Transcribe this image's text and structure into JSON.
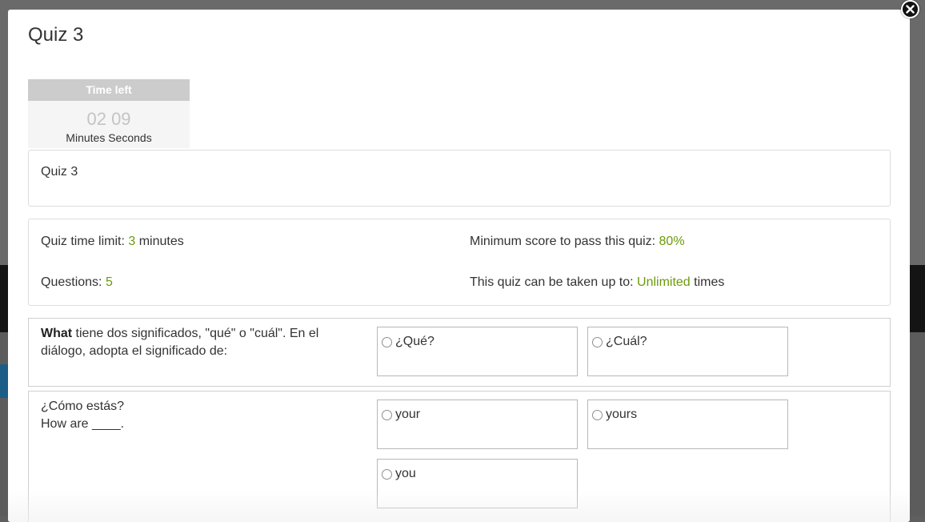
{
  "modal": {
    "title": "Quiz 3"
  },
  "timer": {
    "header": "Time left",
    "minutes": "02",
    "seconds": "09",
    "units": "Minutes Seconds"
  },
  "description": "Quiz 3",
  "info": {
    "time_limit_prefix": "Quiz time limit: ",
    "time_limit_value": "3",
    "time_limit_suffix": " minutes",
    "questions_prefix": "Questions: ",
    "questions_value": "5",
    "min_score_prefix": "Minimum score to pass this quiz: ",
    "min_score_value": "80%",
    "attempts_prefix": "This quiz can be taken up to: ",
    "attempts_value": "Unlimited",
    "attempts_suffix": " times"
  },
  "questions": [
    {
      "bold": "What",
      "text": " tiene dos significados, \"qué\" o \"cuál\". En el diálogo, adopta el significado de:",
      "options": [
        "¿Qué?",
        "¿Cuál?"
      ]
    },
    {
      "line1": "¿Cómo estás?",
      "line2": "How are ____.",
      "options": [
        "your",
        "yours",
        "you"
      ]
    }
  ],
  "colors": {
    "highlight": "#6b9b0a",
    "timer_header": "#cccccc"
  },
  "icons": {
    "close": "close-icon"
  }
}
